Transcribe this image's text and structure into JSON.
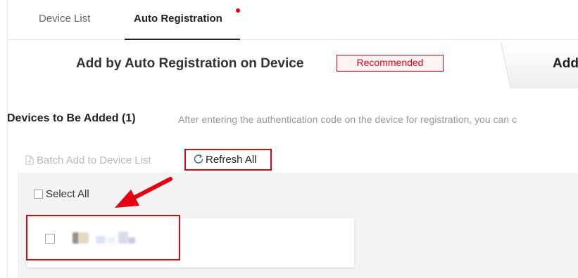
{
  "tabs": {
    "device_list": "Device List",
    "auto_registration": "Auto Registration"
  },
  "header": {
    "title": "Add by Auto Registration on Device",
    "badge": "Recommended",
    "other_tab_partial": "Add"
  },
  "devices_section": {
    "title": "Devices to Be Added (1)",
    "description": "After entering the authentication code on the device for registration, you can c"
  },
  "toolbar": {
    "batch_add_label": "Batch Add to Device List",
    "refresh_all_label": "Refresh All"
  },
  "list": {
    "select_all_label": "Select All"
  },
  "colors": {
    "accent_red": "#e60012",
    "panel_bg": "#f3f3f3",
    "disabled_text": "#b8b8b8"
  },
  "icons": {
    "batch_add": "document-add-icon",
    "refresh": "refresh-icon"
  }
}
